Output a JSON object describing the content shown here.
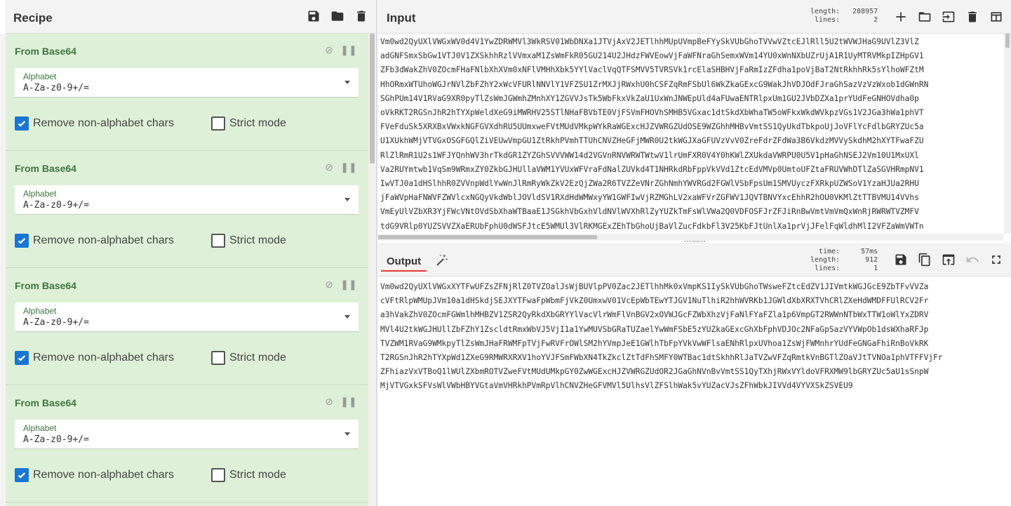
{
  "recipe": {
    "title": "Recipe",
    "header_icons": [
      "save-icon",
      "folder-icon",
      "trash-icon"
    ],
    "operations": [
      {
        "name": "From Base64",
        "alphabet_label": "Alphabet",
        "alphabet_value": "A-Za-z0-9+/=",
        "remove_label": "Remove non-alphabet chars",
        "remove_checked": true,
        "strict_label": "Strict mode",
        "strict_checked": false
      },
      {
        "name": "From Base64",
        "alphabet_label": "Alphabet",
        "alphabet_value": "A-Za-z0-9+/=",
        "remove_label": "Remove non-alphabet chars",
        "remove_checked": true,
        "strict_label": "Strict mode",
        "strict_checked": false
      },
      {
        "name": "From Base64",
        "alphabet_label": "Alphabet",
        "alphabet_value": "A-Za-z0-9+/=",
        "remove_label": "Remove non-alphabet chars",
        "remove_checked": true,
        "strict_label": "Strict mode",
        "strict_checked": false
      },
      {
        "name": "From Base64",
        "alphabet_label": "Alphabet",
        "alphabet_value": "A-Za-z0-9+/=",
        "remove_label": "Remove non-alphabet chars",
        "remove_checked": true,
        "strict_label": "Strict mode",
        "strict_checked": false
      }
    ]
  },
  "input": {
    "title": "Input",
    "stats": {
      "length_label": "length:",
      "length_value": "288957",
      "lines_label": "lines:",
      "lines_value": "2"
    },
    "icons": [
      "plus-icon",
      "folder-icon",
      "import-icon",
      "trash-icon",
      "layout-icon"
    ],
    "lines": [
      "Vm0wd2QyUXlVWGxWV0d4V1YwZDRWMVl3WkRSV01WbDNXa1JTVjAxV2JETlhhMUpUVmpBeFYySkVUbGhoTVVwVZtcEJlRll5U2tWVWJHaG9UVlZ3VlZ",
      "adGNFSmxSbGw1VTJ0V1ZXSkhhRzlVVmxaM1ZsWmFkR05GU214U2JHdzFWVEowVjFaWFNraGhSemxWVm14YU0xWnNXbUZrUjA1R1UyMTRVMkpIZHpGV1",
      "ZFb3dWakZhV0ZOcmFHaFNlbXhXVm0xNFlVMHhXbk5YYlVaclVqQTFSMVV5TVRSVk1rcElaSHBHVjFaRmIzZFdha1poVjBaT2NtRkhhRk5sYlhoWFZtM",
      "HhORmxWTUhoWGJrNVlZbFZhY2xWcVFURlNNVlY1VFZSU1ZrMXJjRWxhU0hCSFZqRmFSbUl6WkZkaGExcG9WakJhVDJOdFJraGhSazVzVzWxob1dGWnRN",
      "SGhPUm14V1RVaG9XR0pyTlZsWmJGWmhZMnhXY1ZGVVJsTk5WbFkxVkZaU1UxWnJNWEpUld4aFUwaENTRlpxUm1GU2JVbDZXa1prYUdFeGNHOVdha0p",
      "oVkRKT2RGSnJhR2hTYXpWeldXeG9iMWRHV25STlNHaFBVbTE0VjFSVmFHOVhSMHB5VGxac1dtSkdXbWhaTW5oWFkxWkdWVkpzVGs1V2JGa3hWa1phVT",
      "FVeFduSk5XRXBxVWxkNGFGVXdhRU5UUmxweFVtMUdVMkpWYkRaWGExcHJZVWRGZUdOSE9WZGhhMHBvVmtSS1QyUkdTbkpoUjJoVFlYcFdlbGRYZUc5a",
      "U1XUkhWMjVTVGxOSGFGQlZiVEUwVmpGU1ZtRkhPVmhTTUhCNVZHeGFjMWR0U2tkWGJXaGFUVzVvV0ZreFdrZFdWa3B6VkdzMVVySkdhM2hXYTFwaFZU",
      "RlZlRmR1U2s1WFJYQnhWV3hrTkdGR1ZYZGhSVVVWW14d2VGVnRNVWRWTWtwV1lrUmFXR0V4Y0hKWlZXUkdaVWRPU0U5V1pHaGhNSEJ2Vm10U1MxUXl",
      "Va2RUYmtwb1VqSm9WRmxZY0ZkbGJHUllaVWM1YVUxWFVraFdNalZUVkd4T1NHRkdRbFppVkVVd1ZtcEdVMVp0UmtoUFZtaFRUVWhDTlZaSGVHRmpNV1",
      "IwVTJ0a1dHSlhhR0ZVVnpWdlYwWnJlRmRyWkZkV2EzQjZWa2R6TVZZeVNrZGhNmhYWVRGd2FGWlVSbFpsUm1SMVUyczFXRkpUZWSoV1YzaHJUa2RHU",
      "jFaWVpHaFNWVFZWVlcxNGQyVkdWblJOVldSV1RXdHdWMWxyYW1GWFIwVjRZMGhLV2xaWFVrZGFWV1JQVTBNVYxcEhhR2hOU0VKMlZtTTBVMU14VVhs",
      "VmEyUlVZbXR3YjFWcVNtOVdSbXhaWTBaaE1JSGkhVbGxhVldNVlWVXhRlZyYUZkTmFsWlVWa2Q0VDFOSFJrZFJiRnBwVmtVmVmQxWnRjRWRWTVZMFV",
      "tdG9VRlp0YUZSVVZXaERUbFphU0dWSFJtcE5WMUl3VlRKMGExZEhTbGhoUjBaVlZucFdkbFl3V25KbFJtUnlXa1prVjJFelFqWldhMlI2VFZaWmVWTn"
    ],
    "h_scroll_pct": 0.35
  },
  "output": {
    "tab_label": "Output",
    "stats": {
      "time_label": "time:",
      "time_value": "57ms",
      "length_label": "length:",
      "length_value": "912",
      "lines_label": "lines:",
      "lines_value": "1"
    },
    "icons": [
      "save-icon",
      "copy-icon",
      "replace-input-icon",
      "undo-icon",
      "fullscreen-icon"
    ],
    "lines": [
      "Vm0wd2QyUXlVWGxXYTFwUFZsZFNjRlZ0TVZOalJsWjBUVlpPV0Zac2JETlhhMk0xVmpKS1IySkVUbGhoTWsweFZtcEdZV1JIVmtkWGJGcE9ZbTFvVVZa",
      "cVFtRlpWMUpJVm10a1dHSkdjSEJXYTFwaFpWbmFjVkZ0UmxwV01VcEpWbTEwYTJGV1NuTlhiR2hhWVRKb1JGWldXbXRXTVhCRlZXeHdWMDFFUlRCV2Fr",
      "a3hVakZhV0ZOcmFGWmlhMHBZV1ZSR2QyRkdXbGRYYlVacVlrWmFlVnBGV2xOVWJGcFZWbXhzVjFaNlFYaFZla1p6VmpGT2RWWnNTbWxTTW1oWlYxZDRV",
      "MVl4U2tkWGJHUllZbFZhY1ZscldtRmxWbVJ5VjI1a1YwMUVSbGRaTUZaelYwWmFSbE5zYUZkaGExcGhXbFphVDJOc2NFaGpSazVYVWpOb1dsWXhaRFJp",
      "TVZWM1RVaG9WMkpyTlZsWmJHaFRWMFpTVjFwRVFrOWlSM2hYVmpJeE1GWlhTbFpYVkVwWFlsaENhRlpxUVhoa1ZsWjFWMnhrYUdFeGNGaFhiRnBoVkRK",
      "T2RGSnJhR2hTYXpWd1ZXeG9RMWRXRXV1hoYVJFSmFWbXN4TkZkclZtTdFhSMFY0WTBac1dtSkhhRlJaTVZwVFZqRmtkVnBGTlZOaVJtTVNOa1phVTFFVjFr",
      "ZFhiazVxVTBoQ1lWUlZXbmROTVZweFVtMUdUMkpGY0ZwWGExcHJZVWRGZUdOR2JGaGhNVnBvVmtSS1QyTXhjRWxVYldoVFRXMW9lbGRYZUc5aU1sSnpW",
      "MjVTVGxkSFVsWlVWbHBYVGtaVmVHRkhPVmRpVlhCNVZHeGFVMVl5UlhsVlZFSlhWak5vYUZacVJsZFhWbkJIVVd4VYVXSkZSVEU9"
    ]
  }
}
